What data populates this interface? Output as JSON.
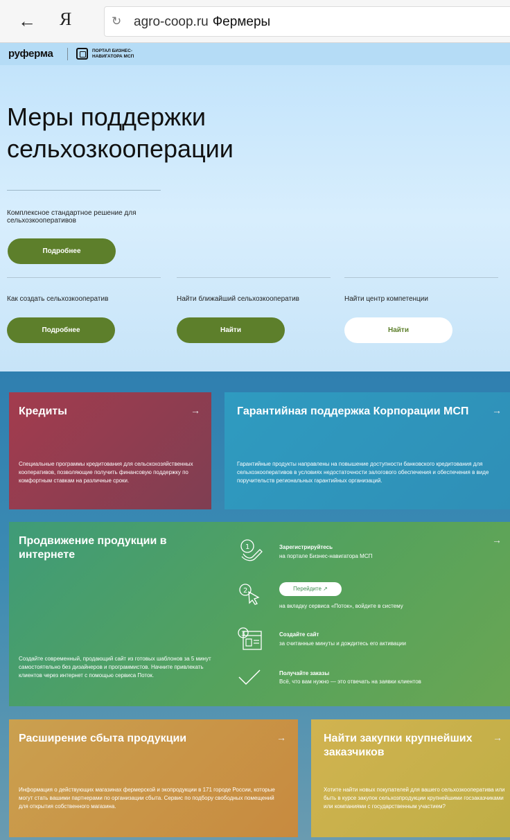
{
  "browser": {
    "back_label": "←",
    "yandex_logo": "Я",
    "reload_icon": "reload-icon",
    "url": "agro-coop.ru",
    "page_title": "Фермеры"
  },
  "header": {
    "logo_text": "руферма",
    "portal_text": "ПОРТАЛ БИЗНЕС-НАВИГАТОРА МСП"
  },
  "hero": {
    "title_line1": "Меры поддержки",
    "title_line2": "сельхозкооперации",
    "subtitle": "Комплексное стандартное решение для сельхозкооперативов",
    "main_button": "Подробнее",
    "columns": [
      {
        "label": "Как создать сельхозкооператив",
        "button": "Подробнее"
      },
      {
        "label": "Найти ближайший сельхозкооператив",
        "button": "Найти"
      },
      {
        "label": "Найти центр компетенции",
        "button": "Найти"
      }
    ]
  },
  "cards": {
    "arrow": "→",
    "credit": {
      "title": "Кредиты",
      "desc": "Специальные программы кредитования для сельскохозяйственных кооперативов, позволяющие получить финансовую поддержку по комфортным ставкам на различные сроки."
    },
    "guarantee": {
      "title": "Гарантийная поддержка Корпорации МСП",
      "desc": "Гарантийные продукты направлены на повышение доступности банковского кредитования для сельхозкооперативов в условиях недостаточности залогового обеспечения и обеспечения в виде поручительств региональных гарантийных организаций."
    },
    "promo": {
      "title": "Продвижение продукции в интернете",
      "desc": "Создайте современный, продающий сайт из готовых шаблонов за 5 минут самостоятельно без дизайнеров и программистов. Начните привлекать клиентов через интернет с помощью сервиса Поток.",
      "steps": [
        {
          "title": "Зарегистрируйтесь",
          "text": "на портале Бизнес-навигатора МСП"
        },
        {
          "button": "Перейдите ↗",
          "text": "на вкладку сервиса «Поток», войдите в систему"
        },
        {
          "title": "Создайте сайт",
          "text": "за считанные минуты и дождитесь его активации"
        },
        {
          "title": "Получайте заказы",
          "text": "Всё, что вам нужно — это отвечать на заявки клиентов"
        }
      ]
    },
    "sales": {
      "title": "Расширение сбыта продукции",
      "desc": "Информация о действующих магазинах фермерской и экопродукции в 171 городе России, которые могут стать вашими партнерами по организации сбыта. Сервис по подбору свободных помещений для открытия собственного магазина."
    },
    "tenders": {
      "title": "Найти закупки крупнейших заказчиков",
      "desc": "Хотите найти новых покупателей для вашего сельхозкооператива или быть в курсе закупок сельхозпродукции крупнейшими госзаказчиками или компаниями с государственным участием?"
    }
  }
}
